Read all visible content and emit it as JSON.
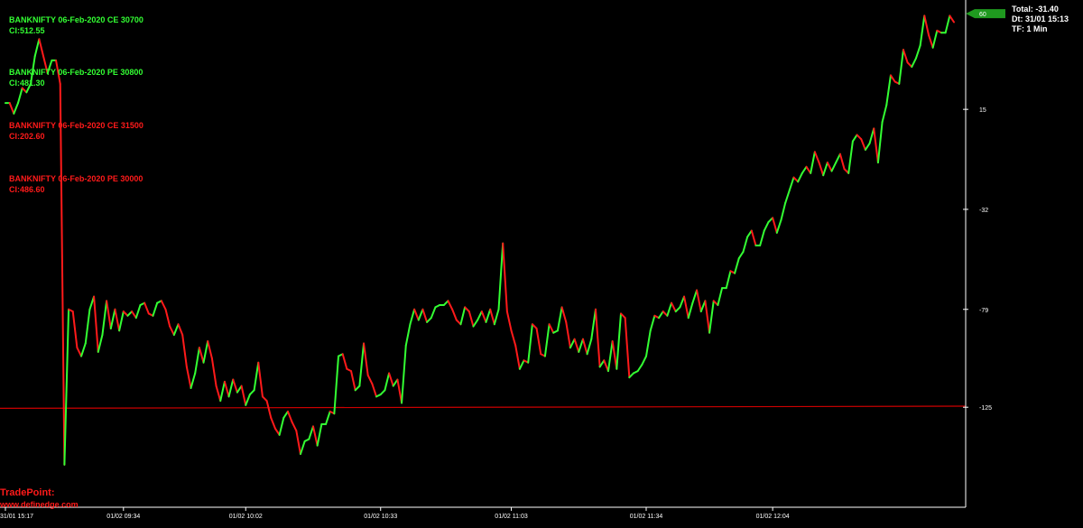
{
  "legend": [
    {
      "name": "BANKNIFTY 06-Feb-2020 CE 30700",
      "ci": "CI:512.55",
      "color": "#33ff33"
    },
    {
      "name": "BANKNIFTY 06-Feb-2020 PE 30800",
      "ci": "CI:481.30",
      "color": "#33ff33"
    },
    {
      "name": "BANKNIFTY 06-Feb-2020 CE 31500",
      "ci": "CI:202.60",
      "color": "#ff1a1a"
    },
    {
      "name": "BANKNIFTY 06-Feb-2020 PE 30000",
      "ci": "CI:486.60",
      "color": "#ff1a1a"
    }
  ],
  "info": {
    "total": "Total: -31.40",
    "dt": "Dt: 31/01 15:13",
    "tf": "TF: 1 Min"
  },
  "branding": {
    "name": "TradePoint:",
    "url": "www.definedge.com"
  },
  "colors": {
    "up": "#33ff33",
    "down": "#ff1a1a",
    "reference_line": "#cc0000",
    "axis": "#ffffff",
    "price_tag": "#1f9a1f"
  },
  "chart_data": {
    "type": "line",
    "title": "",
    "xlabel": "",
    "ylabel": "",
    "ylim": [
      -172,
      63
    ],
    "y_ticks": [
      "60",
      "15",
      "-32",
      "-79",
      "-125"
    ],
    "y_tick_values": [
      60,
      15,
      -32,
      -79,
      -125
    ],
    "x_ticks": [
      "31/01 15:17",
      "01/02 09:34",
      "01/02 10:02",
      "01/02 10:33",
      "01/02 11:03",
      "01/02 11:34",
      "01/02 12:04"
    ],
    "x_tick_positions": [
      0,
      28,
      57,
      89,
      120,
      152,
      182
    ],
    "reference_line": {
      "start": -125.5,
      "end": -124.5
    },
    "current_value": "60",
    "series": [
      {
        "values": [
          18,
          18,
          13,
          18,
          25,
          23,
          27,
          40,
          48,
          40,
          32,
          38,
          38,
          27,
          -152,
          -79,
          -80,
          -97,
          -101,
          -95,
          -79,
          -73,
          -99,
          -91,
          -75,
          -88,
          -79,
          -89,
          -80,
          -82,
          -80,
          -83,
          -77,
          -76,
          -81,
          -82,
          -76,
          -75,
          -79,
          -87,
          -91,
          -86,
          -91,
          -106,
          -116,
          -109,
          -97,
          -104,
          -94,
          -102,
          -115,
          -122,
          -113,
          -120,
          -112,
          -118,
          -115,
          -124,
          -119,
          -117,
          -104,
          -120,
          -122,
          -130,
          -135,
          -138,
          -130,
          -127,
          -132,
          -136,
          -147,
          -141,
          -140,
          -134,
          -143,
          -133,
          -133,
          -127,
          -128,
          -101,
          -100,
          -107,
          -108,
          -117,
          -115,
          -95,
          -110,
          -114,
          -120,
          -119,
          -117,
          -109,
          -115,
          -112,
          -123,
          -96,
          -86,
          -79,
          -84,
          -79,
          -85,
          -83,
          -78,
          -77,
          -77,
          -75,
          -79,
          -84,
          -86,
          -78,
          -80,
          -87,
          -84,
          -80,
          -85,
          -79,
          -86,
          -79,
          -48,
          -80,
          -89,
          -96,
          -107,
          -103,
          -104,
          -86,
          -88,
          -100,
          -101,
          -86,
          -90,
          -89,
          -78,
          -85,
          -97,
          -93,
          -99,
          -93,
          -100,
          -93,
          -79,
          -106,
          -103,
          -108,
          -94,
          -107,
          -81,
          -83,
          -111,
          -109,
          -108,
          -105,
          -101,
          -89,
          -82,
          -83,
          -80,
          -82,
          -76,
          -80,
          -78,
          -73,
          -83,
          -76,
          -70,
          -80,
          -75,
          -90,
          -75,
          -77,
          -69,
          -69,
          -61,
          -62,
          -55,
          -52,
          -45,
          -42,
          -49,
          -49,
          -42,
          -38,
          -36,
          -43,
          -37,
          -29,
          -23,
          -17,
          -19,
          -15,
          -12,
          -15,
          -5,
          -10,
          -16,
          -10,
          -14,
          -10,
          -6,
          -13,
          -15,
          0,
          3,
          1,
          -4,
          -1,
          6,
          -10,
          9,
          17,
          31,
          28,
          27,
          43,
          37,
          35,
          39,
          45,
          59,
          50,
          44,
          52,
          51,
          51,
          59,
          56
        ]
      }
    ]
  }
}
